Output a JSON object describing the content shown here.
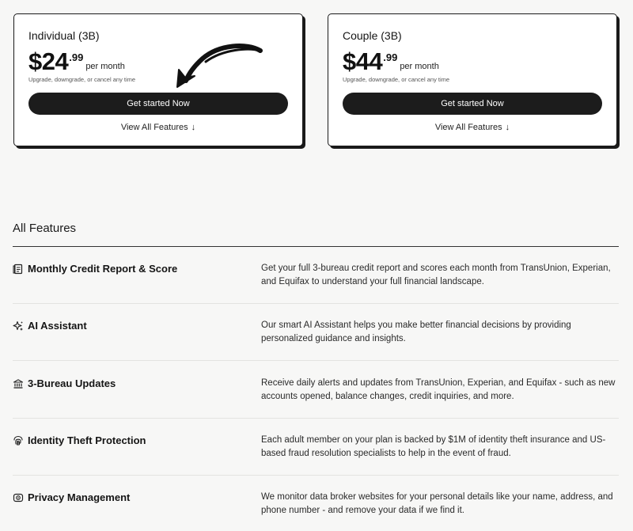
{
  "plans": [
    {
      "name": "Individual (3B)",
      "price_main": "$24",
      "price_cents": ".99",
      "period": "per month",
      "note": "Upgrade, downgrade, or cancel any time",
      "cta": "Get started Now",
      "features_link": "View All Features"
    },
    {
      "name": "Couple (3B)",
      "price_main": "$44",
      "price_cents": ".99",
      "period": "per month",
      "note": "Upgrade, downgrade, or cancel any time",
      "cta": "Get started Now",
      "features_link": "View All Features"
    }
  ],
  "all_features": {
    "heading": "All Features",
    "items": [
      {
        "icon": "document-icon",
        "title": "Monthly Credit Report & Score",
        "desc": "Get your full 3-bureau credit report and scores each month from TransUnion, Experian, and Equifax to understand your full financial landscape."
      },
      {
        "icon": "sparkle-icon",
        "title": "AI Assistant",
        "desc": "Our smart AI Assistant helps you make better financial decisions by providing personalized guidance and insights."
      },
      {
        "icon": "bank-icon",
        "title": "3-Bureau Updates",
        "desc": "Receive daily alerts and updates from TransUnion, Experian, and Equifax - such as new accounts opened, balance changes, credit inquiries, and more."
      },
      {
        "icon": "fingerprint-icon",
        "title": "Identity Theft Protection",
        "desc": "Each adult member on your plan is backed by $1M of identity theft insurance and US-based fraud resolution specialists to help in the event of fraud."
      },
      {
        "icon": "privacy-icon",
        "title": "Privacy Management",
        "desc": "We monitor data broker websites for your personal details like your name, address, and phone number - and remove your data if we find it."
      }
    ]
  }
}
